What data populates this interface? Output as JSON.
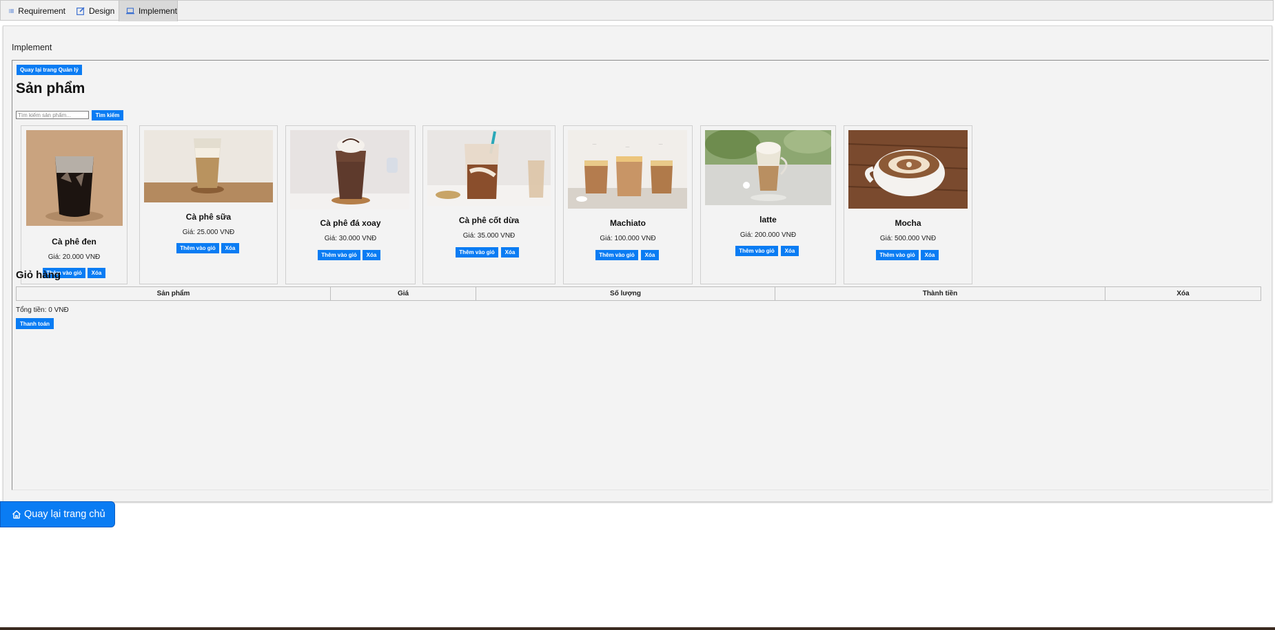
{
  "tabs": [
    {
      "label": "Requirement",
      "icon": "list-icon"
    },
    {
      "label": "Design",
      "icon": "edit-icon"
    },
    {
      "label": "Implement",
      "icon": "laptop-icon",
      "active": true
    }
  ],
  "section_title": "Implement",
  "back_admin_label": "Quay lại trang Quản lý",
  "products_heading": "Sản phẩm",
  "search": {
    "placeholder": "Tìm kiếm sản phẩm...",
    "value": "",
    "button_label": "Tìm kiếm"
  },
  "products": [
    {
      "name": "Cà phê đen",
      "price": "Giá: 20.000 VNĐ",
      "add_label": "Thêm vào giỏ",
      "delete_label": "Xóa"
    },
    {
      "name": "Cà phê sữa",
      "price": "Giá: 25.000 VNĐ",
      "add_label": "Thêm vào giỏ",
      "delete_label": "Xóa"
    },
    {
      "name": "Cà phê đá xoay",
      "price": "Giá: 30.000 VNĐ",
      "add_label": "Thêm vào giỏ",
      "delete_label": "Xóa"
    },
    {
      "name": "Cà phê cốt dừa",
      "price": "Giá: 35.000 VNĐ",
      "add_label": "Thêm vào giỏ",
      "delete_label": "Xóa"
    },
    {
      "name": "Machiato",
      "price": "Giá: 100.000 VNĐ",
      "add_label": "Thêm vào giỏ",
      "delete_label": "Xóa"
    },
    {
      "name": "latte",
      "price": "Giá: 200.000 VNĐ",
      "add_label": "Thêm vào giỏ",
      "delete_label": "Xóa"
    },
    {
      "name": "Mocha",
      "price": "Giá: 500.000 VNĐ",
      "add_label": "Thêm vào giỏ",
      "delete_label": "Xóa"
    }
  ],
  "cart": {
    "heading": "Giỏ hàng",
    "columns": [
      "Sản phẩm",
      "Giá",
      "Số lượng",
      "Thành tiền",
      "Xóa"
    ],
    "total": "Tổng tiền: 0 VNĐ",
    "checkout_label": "Thanh toán"
  },
  "home_button_label": "Quay lại trang chủ",
  "colors": {
    "accent": "#0a7cf3",
    "panel": "#f3f3f3",
    "tabbar": "#f0f0f0"
  }
}
